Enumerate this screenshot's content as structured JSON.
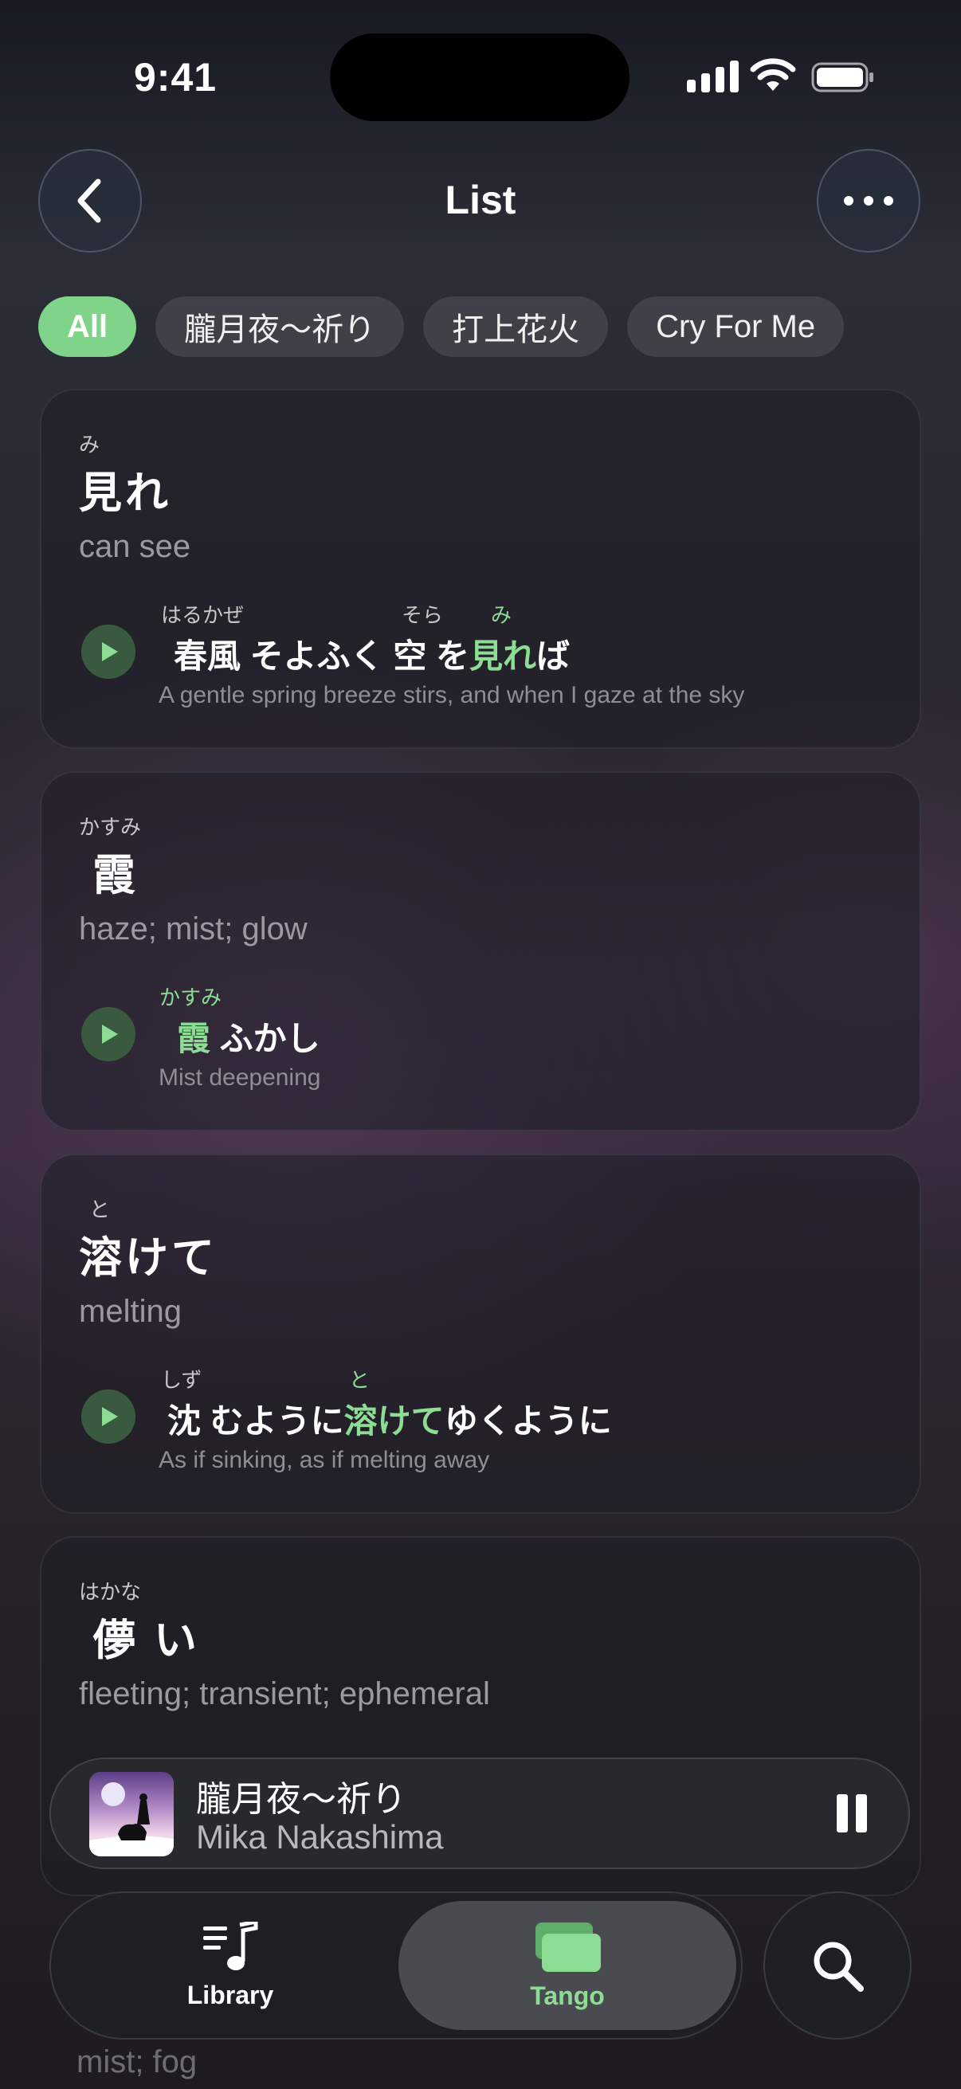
{
  "status": {
    "time": "9:41"
  },
  "header": {
    "title": "List",
    "back_icon": "chevron-left-icon",
    "more_icon": "ellipsis-icon"
  },
  "filters": [
    "All",
    "朧月夜〜祈り",
    "打上花火",
    "Cry For Me"
  ],
  "cards": [
    {
      "furigana": "み",
      "word": "見れ",
      "meaning": "can see",
      "lyric": {
        "pre": "春風 そよふく 空 を",
        "hl": "見れ",
        "post": "ば"
      },
      "lyric_furigana": [
        "はるかぜ",
        "そら",
        "み"
      ],
      "translation": "A gentle spring breeze stirs, and when I gaze at the sky"
    },
    {
      "furigana": "かすみ",
      "word": "霞",
      "meaning": "haze; mist; glow",
      "lyric": {
        "pre": "",
        "hl": "霞",
        "post": " ふかし"
      },
      "lyric_furigana": [
        "かすみ"
      ],
      "translation": "Mist deepening"
    },
    {
      "furigana": "と",
      "word": "溶けて",
      "meaning": "melting",
      "lyric": {
        "pre": "沈 むように",
        "hl": "溶けて",
        "post": "ゆくように"
      },
      "lyric_furigana": [
        "しず",
        "と"
      ],
      "translation": "As if sinking, as if melting away"
    },
    {
      "furigana": "はかな",
      "word": "儚 い",
      "meaning": "fleeting; transient; ephemeral"
    }
  ],
  "now_playing": {
    "song": "朧月夜〜祈り",
    "artist": "Mika Nakashima"
  },
  "tabs": [
    {
      "label": "Library",
      "icon": "music-library-icon"
    },
    {
      "label": "Tango",
      "icon": "cards-icon"
    }
  ],
  "peek": "mist; fog",
  "colors": {
    "accent": "#7fd48a"
  }
}
